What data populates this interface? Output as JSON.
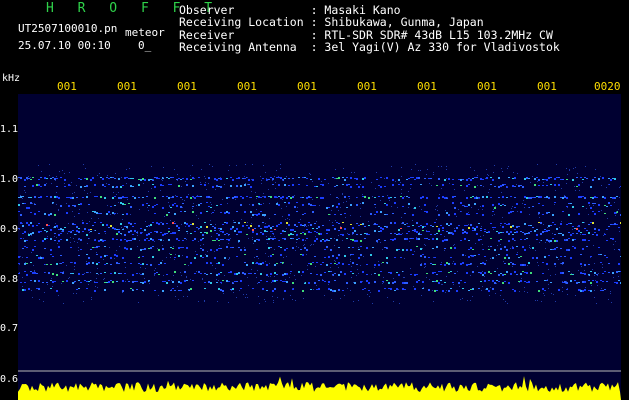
{
  "header": {
    "logo": "H R O F F T",
    "filename": "UT2507100010.pn",
    "mode": "meteor",
    "datetime": "25.07.10 00:10",
    "counter": "0_"
  },
  "info": [
    {
      "label": "Observer          ",
      "value": ": Masaki Kano"
    },
    {
      "label": "Receiving Location",
      "value": ": Shibukawa, Gunma, Japan"
    },
    {
      "label": "Receiver          ",
      "value": ": RTL-SDR SDR# 43dB L15 103.2MHz CW"
    },
    {
      "label": "Receiving Antenna ",
      "value": ": 3el Yagi(V) Az 330 for Vladivostok"
    }
  ],
  "axis": {
    "unit": "kHz",
    "x_ticks": [
      "001",
      "001",
      "001",
      "001",
      "001",
      "001",
      "001",
      "001",
      "001",
      "0020"
    ],
    "y_ticks": [
      "1.1",
      "1.0",
      "0.9",
      "0.8",
      "0.7",
      "0.6"
    ]
  },
  "colors": {
    "background": "#000031",
    "tick_text": "#ffdf00",
    "logo": "#2fd24a",
    "power_trace": "#ffff00"
  }
}
